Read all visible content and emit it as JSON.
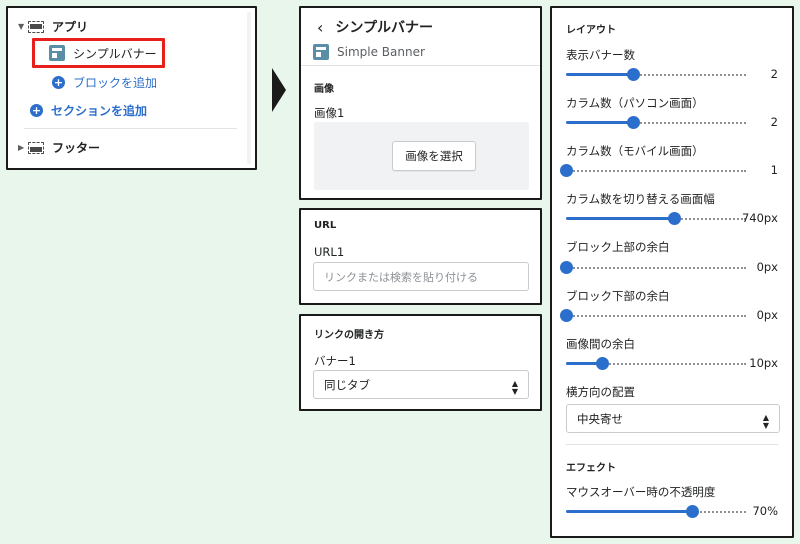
{
  "tree": {
    "section_app": "アプリ",
    "block_simple_banner": "シンプルバナー",
    "add_block": "ブロックを追加",
    "add_section": "セクションを追加",
    "section_footer": "フッター"
  },
  "image_panel": {
    "title": "シンプルバナー",
    "subtitle": "Simple Banner",
    "section": "画像",
    "field_label": "画像1",
    "select_button": "画像を選択"
  },
  "url_panel": {
    "section": "URL",
    "field_label": "URL1",
    "placeholder": "リンクまたは検索を貼り付ける"
  },
  "link_panel": {
    "section": "リンクの開き方",
    "field_label": "バナー1",
    "selected": "同じタブ"
  },
  "layout_panel": {
    "section": "レイアウト",
    "banner_count": {
      "label": "表示バナー数",
      "value": "2",
      "fraction": 0.37
    },
    "columns_pc": {
      "label": "カラム数（パソコン画面）",
      "value": "2",
      "fraction": 0.37
    },
    "columns_mobile": {
      "label": "カラム数（モバイル画面）",
      "value": "1",
      "fraction": 0.0
    },
    "switch_width": {
      "label": "カラム数を切り替える画面幅",
      "value": "740px",
      "fraction": 0.6
    },
    "block_top_margin": {
      "label": "ブロック上部の余白",
      "value": "0px",
      "fraction": 0.0
    },
    "block_bottom_margin": {
      "label": "ブロック下部の余白",
      "value": "0px",
      "fraction": 0.0
    },
    "image_gap": {
      "label": "画像間の余白",
      "value": "10px",
      "fraction": 0.2
    },
    "horizontal_align": {
      "label": "横方向の配置",
      "selected": "中央寄せ"
    },
    "effect_section": "エフェクト",
    "hover_opacity": {
      "label": "マウスオーバー時の不透明度",
      "value": "70%",
      "fraction": 0.7
    }
  },
  "colors": {
    "accent": "#2c6ecb",
    "highlight": "#e8201c",
    "background": "#e9f6ec"
  }
}
